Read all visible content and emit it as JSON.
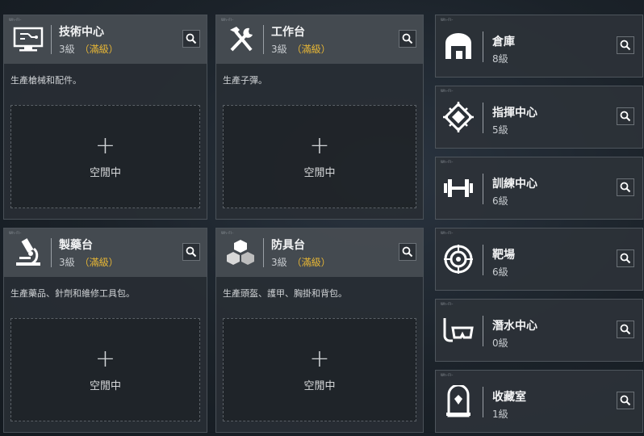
{
  "ui": {
    "maxed_label": "（滿級）",
    "slot_plus": "+",
    "slot_idle": "空閒中",
    "micro_label": "Wh–Fl–"
  },
  "large_cards": [
    {
      "name": "技術中心",
      "level": "3級",
      "maxed": true,
      "description": "生產槍械和配件。",
      "icon": "computer-icon"
    },
    {
      "name": "工作台",
      "level": "3級",
      "maxed": true,
      "description": "生產子彈。",
      "icon": "hammer-wrench-icon"
    },
    {
      "name": "製藥台",
      "level": "3級",
      "maxed": true,
      "description": "生產藥品、針劑和維修工具包。",
      "icon": "microscope-icon"
    },
    {
      "name": "防具台",
      "level": "3級",
      "maxed": true,
      "description": "生產頭盔、護甲、胸掛和背包。",
      "icon": "cubes-icon"
    }
  ],
  "small_cards": [
    {
      "name": "倉庫",
      "level": "8級",
      "icon": "warehouse-icon"
    },
    {
      "name": "指揮中心",
      "level": "5級",
      "icon": "command-chip-icon"
    },
    {
      "name": "訓練中心",
      "level": "6級",
      "icon": "dumbbell-icon"
    },
    {
      "name": "靶場",
      "level": "6級",
      "icon": "target-icon"
    },
    {
      "name": "潛水中心",
      "level": "0級",
      "icon": "diving-mask-icon"
    },
    {
      "name": "收藏室",
      "level": "1級",
      "icon": "trophy-case-icon"
    }
  ],
  "colors": {
    "maxed": "#e8b735",
    "accent_bg": "#4a5056"
  }
}
